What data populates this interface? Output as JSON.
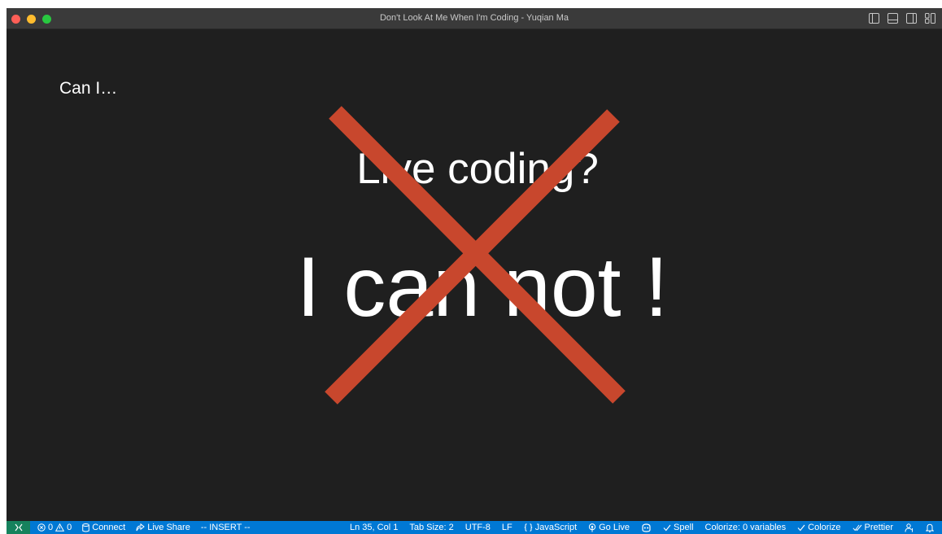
{
  "window": {
    "title": "Don't Look At Me When I'm Coding - Yuqian Ma"
  },
  "slide": {
    "heading": "Can I…",
    "question": "Live coding?",
    "answer": "I can not !",
    "cross_icon": "red-x-cross",
    "cross_color": "#c8472d"
  },
  "statusbar": {
    "remote_icon": "remote-icon",
    "errors": "0",
    "warnings": "0",
    "connect": "Connect",
    "live_share": "Live Share",
    "mode": "-- INSERT --",
    "position": "Ln 35, Col 1",
    "tab_size": "Tab Size: 2",
    "encoding": "UTF-8",
    "eol": "LF",
    "language": "JavaScript",
    "go_live": "Go Live",
    "spell": "Spell",
    "colorize_vars": "Colorize: 0 variables",
    "colorize": "Colorize",
    "prettier": "Prettier",
    "accent_color": "#0078d4",
    "remote_color": "#16825d"
  }
}
